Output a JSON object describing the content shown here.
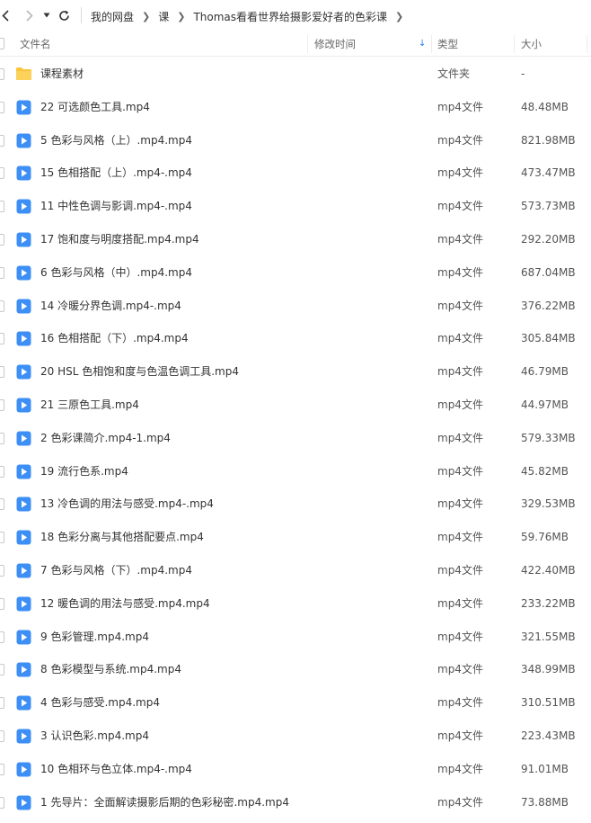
{
  "nav": {
    "back_icon": "chevron-left-icon",
    "forward_icon": "chevron-right-icon",
    "dropdown_icon": "caret-down-icon",
    "refresh_icon": "refresh-icon"
  },
  "breadcrumb": [
    "我的网盘",
    "课",
    "Thomas看看世界给摄影爱好者的色彩课"
  ],
  "columns": {
    "name": "文件名",
    "modified": "修改时间",
    "type": "类型",
    "size": "大小"
  },
  "colors": {
    "accent": "#1f7ef5",
    "folder": "#fbc53b",
    "video": "#3d8ff5"
  },
  "files": [
    {
      "name": "课程素材",
      "type": "文件夹",
      "size": "-",
      "kind": "folder"
    },
    {
      "name": "22 可选颜色工具.mp4",
      "type": "mp4文件",
      "size": "48.48MB",
      "kind": "video"
    },
    {
      "name": "5 色彩与风格（上）.mp4.mp4",
      "type": "mp4文件",
      "size": "821.98MB",
      "kind": "video"
    },
    {
      "name": "15 色相搭配（上）.mp4-.mp4",
      "type": "mp4文件",
      "size": "473.47MB",
      "kind": "video"
    },
    {
      "name": "11 中性色调与影调.mp4-.mp4",
      "type": "mp4文件",
      "size": "573.73MB",
      "kind": "video"
    },
    {
      "name": "17 饱和度与明度搭配.mp4.mp4",
      "type": "mp4文件",
      "size": "292.20MB",
      "kind": "video"
    },
    {
      "name": "6 色彩与风格（中）.mp4.mp4",
      "type": "mp4文件",
      "size": "687.04MB",
      "kind": "video"
    },
    {
      "name": "14 冷暖分界色调.mp4-.mp4",
      "type": "mp4文件",
      "size": "376.22MB",
      "kind": "video"
    },
    {
      "name": "16 色相搭配（下）.mp4.mp4",
      "type": "mp4文件",
      "size": "305.84MB",
      "kind": "video"
    },
    {
      "name": "20 HSL 色相饱和度与色温色调工具.mp4",
      "type": "mp4文件",
      "size": "46.79MB",
      "kind": "video"
    },
    {
      "name": "21 三原色工具.mp4",
      "type": "mp4文件",
      "size": "44.97MB",
      "kind": "video"
    },
    {
      "name": "2 色彩课简介.mp4-1.mp4",
      "type": "mp4文件",
      "size": "579.33MB",
      "kind": "video"
    },
    {
      "name": "19 流行色系.mp4",
      "type": "mp4文件",
      "size": "45.82MB",
      "kind": "video"
    },
    {
      "name": "13 冷色调的用法与感受.mp4-.mp4",
      "type": "mp4文件",
      "size": "329.53MB",
      "kind": "video"
    },
    {
      "name": "18 色彩分离与其他搭配要点.mp4",
      "type": "mp4文件",
      "size": "59.76MB",
      "kind": "video"
    },
    {
      "name": "7 色彩与风格（下）.mp4.mp4",
      "type": "mp4文件",
      "size": "422.40MB",
      "kind": "video"
    },
    {
      "name": "12 暖色调的用法与感受.mp4.mp4",
      "type": "mp4文件",
      "size": "233.22MB",
      "kind": "video"
    },
    {
      "name": "9 色彩管理.mp4.mp4",
      "type": "mp4文件",
      "size": "321.55MB",
      "kind": "video"
    },
    {
      "name": "8 色彩模型与系统.mp4.mp4",
      "type": "mp4文件",
      "size": "348.99MB",
      "kind": "video"
    },
    {
      "name": "4 色彩与感受.mp4.mp4",
      "type": "mp4文件",
      "size": "310.51MB",
      "kind": "video"
    },
    {
      "name": "3 认识色彩.mp4.mp4",
      "type": "mp4文件",
      "size": "223.43MB",
      "kind": "video"
    },
    {
      "name": "10 色相环与色立体.mp4-.mp4",
      "type": "mp4文件",
      "size": "91.01MB",
      "kind": "video"
    },
    {
      "name": "1 先导片：全面解读摄影后期的色彩秘密.mp4.mp4",
      "type": "mp4文件",
      "size": "73.88MB",
      "kind": "video"
    }
  ]
}
